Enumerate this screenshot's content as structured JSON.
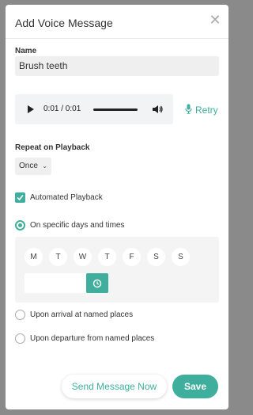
{
  "dialog": {
    "title": "Add Voice Message",
    "close_icon": "close-icon"
  },
  "name": {
    "label": "Name",
    "value": "Brush teeth"
  },
  "audio": {
    "time": "0:01 / 0:01",
    "play_icon": "play-icon",
    "volume_icon": "volume-icon"
  },
  "retry": {
    "label": "Retry",
    "icon": "microphone-icon"
  },
  "repeat": {
    "label": "Repeat on Playback",
    "selected": "Once"
  },
  "automated": {
    "label": "Automated Playback",
    "checked": true
  },
  "options": {
    "specific": "On specific days and times",
    "arrival": "Upon arrival at named places",
    "departure": "Upon departure from named places"
  },
  "days": [
    "M",
    "T",
    "W",
    "T",
    "F",
    "S",
    "S"
  ],
  "time": {
    "value": "",
    "icon": "clock-icon"
  },
  "footer": {
    "send_label": "Send Message Now",
    "save_label": "Save"
  },
  "colors": {
    "accent": "#3fae9c"
  }
}
